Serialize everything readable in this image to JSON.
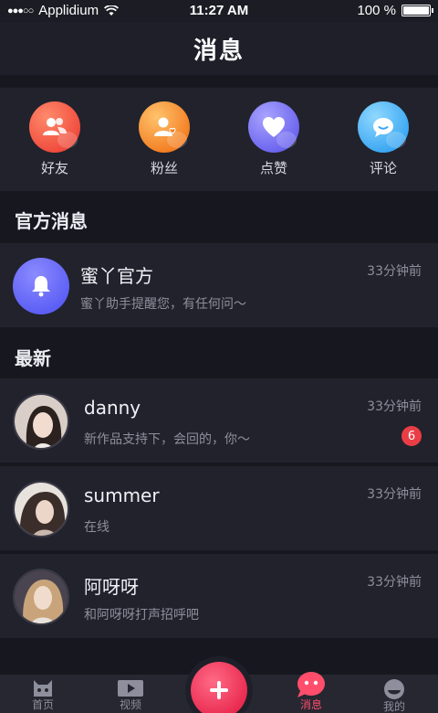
{
  "status_bar": {
    "carrier": "Applidium",
    "time": "11:27 AM",
    "battery": "100 %"
  },
  "header": {
    "title": "消息"
  },
  "quick_actions": [
    {
      "label": "好友",
      "icon": "friends-icon"
    },
    {
      "label": "粉丝",
      "icon": "fans-icon"
    },
    {
      "label": "点赞",
      "icon": "heart-icon"
    },
    {
      "label": "评论",
      "icon": "comment-icon"
    }
  ],
  "official": {
    "section_title": "官方消息",
    "name": "蜜丫官方",
    "preview": "蜜丫助手提醒您，有任何问～",
    "time": "33分钟前"
  },
  "latest": {
    "section_title": "最新",
    "messages": [
      {
        "name": "danny",
        "preview": "新作品支持下，会回的，你～",
        "time": "33分钟前",
        "badge": "6"
      },
      {
        "name": "summer",
        "preview": "在线",
        "time": "33分钟前"
      },
      {
        "name": "阿呀呀",
        "preview": "和阿呀呀打声招呼吧",
        "time": "33分钟前"
      }
    ]
  },
  "tab_bar": {
    "items": [
      {
        "label": "首页",
        "icon": "home-icon"
      },
      {
        "label": "视频",
        "icon": "video-icon"
      },
      {
        "label": "消息",
        "icon": "message-icon",
        "active": true
      },
      {
        "label": "我的",
        "icon": "profile-icon"
      }
    ]
  },
  "colors": {
    "accent": "#ff4e6c",
    "background": "#17181f",
    "card": "#21222c"
  }
}
